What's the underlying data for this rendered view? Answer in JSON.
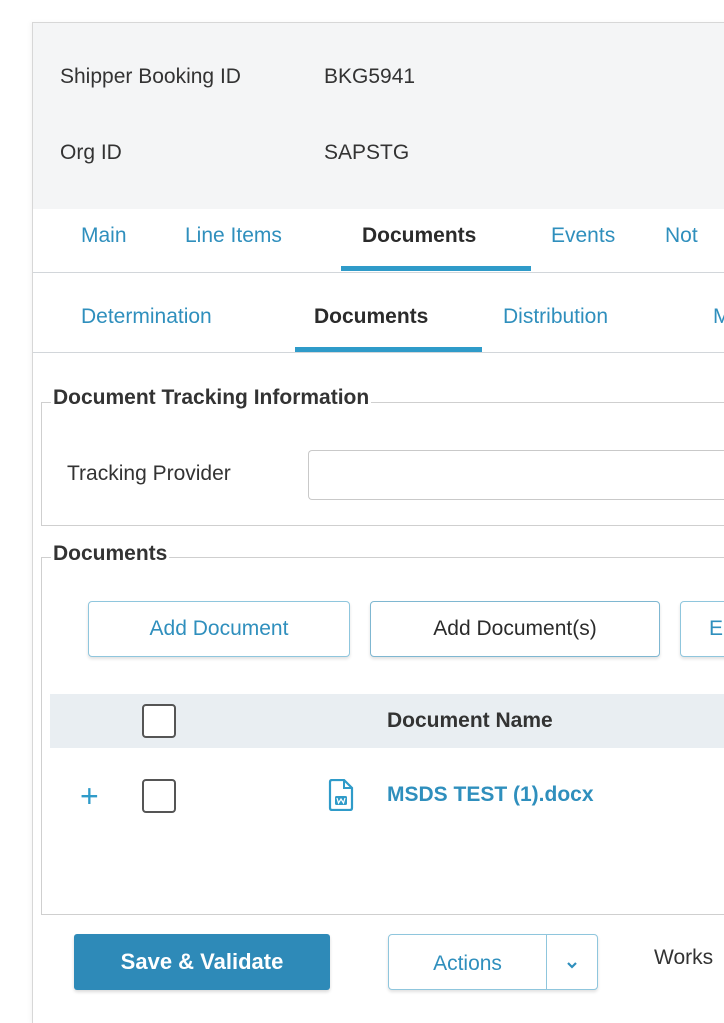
{
  "header": {
    "shipper_booking_label": "Shipper Booking ID",
    "shipper_booking_value": "BKG5941",
    "org_label": "Org ID",
    "org_value": "SAPSTG"
  },
  "main_tabs": [
    {
      "label": "Main",
      "active": false
    },
    {
      "label": "Line Items",
      "active": false
    },
    {
      "label": "Documents",
      "active": true
    },
    {
      "label": "Events",
      "active": false
    },
    {
      "label": "Not",
      "active": false
    }
  ],
  "sub_tabs": [
    {
      "label": "Determination",
      "active": false
    },
    {
      "label": "Documents",
      "active": true
    },
    {
      "label": "Distribution",
      "active": false
    },
    {
      "label": "M",
      "active": false
    }
  ],
  "tracking": {
    "legend": "Document Tracking Information",
    "provider_label": "Tracking Provider",
    "provider_value": ""
  },
  "documents": {
    "legend": "Documents",
    "add_document_label": "Add Document",
    "add_documents_label": "Add Document(s)",
    "third_button_label": "E",
    "column_document_name": "Document Name",
    "rows": [
      {
        "name": "MSDS TEST (1).docx",
        "icon": "word-document-icon"
      }
    ]
  },
  "footer": {
    "save_label": "Save & Validate",
    "actions_label": "Actions",
    "workflow_text": "Works"
  },
  "colors": {
    "accent": "#2f9bc9",
    "link": "#2f8fbd",
    "primary_button": "#2e8ab8",
    "header_bg": "#f4f5f6",
    "table_header_bg": "#e9eef2"
  }
}
